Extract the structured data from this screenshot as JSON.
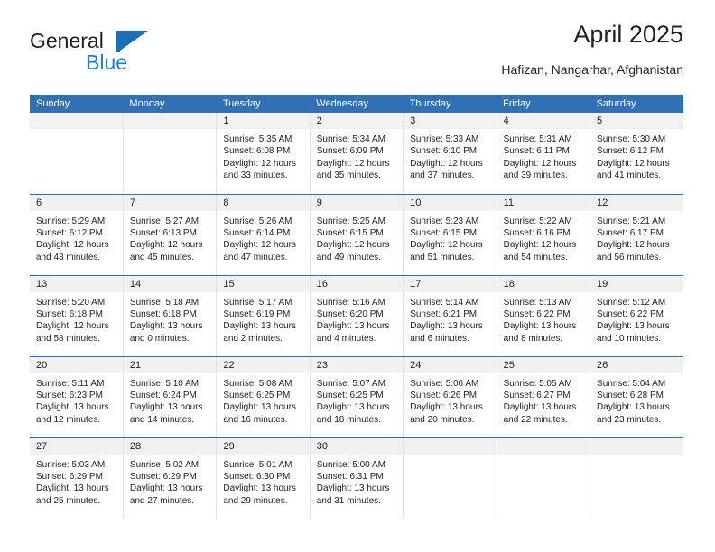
{
  "brand": {
    "name_part1": "General",
    "name_part2": "Blue",
    "logo_icon": "flag-triangle-icon"
  },
  "header": {
    "title": "April 2025",
    "location": "Hafizan, Nangarhar, Afghanistan"
  },
  "colors": {
    "header_blue": "#2f71b4",
    "brand_blue": "#1c7fd6",
    "daynum_band": "#f1f1f1",
    "text": "#231f20"
  },
  "weekdays": [
    "Sunday",
    "Monday",
    "Tuesday",
    "Wednesday",
    "Thursday",
    "Friday",
    "Saturday"
  ],
  "labels": {
    "sunrise": "Sunrise:",
    "sunset": "Sunset:",
    "daylight": "Daylight:"
  },
  "weeks": [
    [
      {
        "day": "",
        "blank": true
      },
      {
        "day": "",
        "blank": true
      },
      {
        "day": "1",
        "sunrise": "Sunrise: 5:35 AM",
        "sunset": "Sunset: 6:08 PM",
        "daylight": "Daylight: 12 hours and 33 minutes."
      },
      {
        "day": "2",
        "sunrise": "Sunrise: 5:34 AM",
        "sunset": "Sunset: 6:09 PM",
        "daylight": "Daylight: 12 hours and 35 minutes."
      },
      {
        "day": "3",
        "sunrise": "Sunrise: 5:33 AM",
        "sunset": "Sunset: 6:10 PM",
        "daylight": "Daylight: 12 hours and 37 minutes."
      },
      {
        "day": "4",
        "sunrise": "Sunrise: 5:31 AM",
        "sunset": "Sunset: 6:11 PM",
        "daylight": "Daylight: 12 hours and 39 minutes."
      },
      {
        "day": "5",
        "sunrise": "Sunrise: 5:30 AM",
        "sunset": "Sunset: 6:12 PM",
        "daylight": "Daylight: 12 hours and 41 minutes."
      }
    ],
    [
      {
        "day": "6",
        "sunrise": "Sunrise: 5:29 AM",
        "sunset": "Sunset: 6:12 PM",
        "daylight": "Daylight: 12 hours and 43 minutes."
      },
      {
        "day": "7",
        "sunrise": "Sunrise: 5:27 AM",
        "sunset": "Sunset: 6:13 PM",
        "daylight": "Daylight: 12 hours and 45 minutes."
      },
      {
        "day": "8",
        "sunrise": "Sunrise: 5:26 AM",
        "sunset": "Sunset: 6:14 PM",
        "daylight": "Daylight: 12 hours and 47 minutes."
      },
      {
        "day": "9",
        "sunrise": "Sunrise: 5:25 AM",
        "sunset": "Sunset: 6:15 PM",
        "daylight": "Daylight: 12 hours and 49 minutes."
      },
      {
        "day": "10",
        "sunrise": "Sunrise: 5:23 AM",
        "sunset": "Sunset: 6:15 PM",
        "daylight": "Daylight: 12 hours and 51 minutes."
      },
      {
        "day": "11",
        "sunrise": "Sunrise: 5:22 AM",
        "sunset": "Sunset: 6:16 PM",
        "daylight": "Daylight: 12 hours and 54 minutes."
      },
      {
        "day": "12",
        "sunrise": "Sunrise: 5:21 AM",
        "sunset": "Sunset: 6:17 PM",
        "daylight": "Daylight: 12 hours and 56 minutes."
      }
    ],
    [
      {
        "day": "13",
        "sunrise": "Sunrise: 5:20 AM",
        "sunset": "Sunset: 6:18 PM",
        "daylight": "Daylight: 12 hours and 58 minutes."
      },
      {
        "day": "14",
        "sunrise": "Sunrise: 5:18 AM",
        "sunset": "Sunset: 6:18 PM",
        "daylight": "Daylight: 13 hours and 0 minutes."
      },
      {
        "day": "15",
        "sunrise": "Sunrise: 5:17 AM",
        "sunset": "Sunset: 6:19 PM",
        "daylight": "Daylight: 13 hours and 2 minutes."
      },
      {
        "day": "16",
        "sunrise": "Sunrise: 5:16 AM",
        "sunset": "Sunset: 6:20 PM",
        "daylight": "Daylight: 13 hours and 4 minutes."
      },
      {
        "day": "17",
        "sunrise": "Sunrise: 5:14 AM",
        "sunset": "Sunset: 6:21 PM",
        "daylight": "Daylight: 13 hours and 6 minutes."
      },
      {
        "day": "18",
        "sunrise": "Sunrise: 5:13 AM",
        "sunset": "Sunset: 6:22 PM",
        "daylight": "Daylight: 13 hours and 8 minutes."
      },
      {
        "day": "19",
        "sunrise": "Sunrise: 5:12 AM",
        "sunset": "Sunset: 6:22 PM",
        "daylight": "Daylight: 13 hours and 10 minutes."
      }
    ],
    [
      {
        "day": "20",
        "sunrise": "Sunrise: 5:11 AM",
        "sunset": "Sunset: 6:23 PM",
        "daylight": "Daylight: 13 hours and 12 minutes."
      },
      {
        "day": "21",
        "sunrise": "Sunrise: 5:10 AM",
        "sunset": "Sunset: 6:24 PM",
        "daylight": "Daylight: 13 hours and 14 minutes."
      },
      {
        "day": "22",
        "sunrise": "Sunrise: 5:08 AM",
        "sunset": "Sunset: 6:25 PM",
        "daylight": "Daylight: 13 hours and 16 minutes."
      },
      {
        "day": "23",
        "sunrise": "Sunrise: 5:07 AM",
        "sunset": "Sunset: 6:25 PM",
        "daylight": "Daylight: 13 hours and 18 minutes."
      },
      {
        "day": "24",
        "sunrise": "Sunrise: 5:06 AM",
        "sunset": "Sunset: 6:26 PM",
        "daylight": "Daylight: 13 hours and 20 minutes."
      },
      {
        "day": "25",
        "sunrise": "Sunrise: 5:05 AM",
        "sunset": "Sunset: 6:27 PM",
        "daylight": "Daylight: 13 hours and 22 minutes."
      },
      {
        "day": "26",
        "sunrise": "Sunrise: 5:04 AM",
        "sunset": "Sunset: 6:28 PM",
        "daylight": "Daylight: 13 hours and 23 minutes."
      }
    ],
    [
      {
        "day": "27",
        "sunrise": "Sunrise: 5:03 AM",
        "sunset": "Sunset: 6:29 PM",
        "daylight": "Daylight: 13 hours and 25 minutes."
      },
      {
        "day": "28",
        "sunrise": "Sunrise: 5:02 AM",
        "sunset": "Sunset: 6:29 PM",
        "daylight": "Daylight: 13 hours and 27 minutes."
      },
      {
        "day": "29",
        "sunrise": "Sunrise: 5:01 AM",
        "sunset": "Sunset: 6:30 PM",
        "daylight": "Daylight: 13 hours and 29 minutes."
      },
      {
        "day": "30",
        "sunrise": "Sunrise: 5:00 AM",
        "sunset": "Sunset: 6:31 PM",
        "daylight": "Daylight: 13 hours and 31 minutes."
      },
      {
        "day": "",
        "blank": true
      },
      {
        "day": "",
        "blank": true
      },
      {
        "day": "",
        "blank": true
      }
    ]
  ]
}
